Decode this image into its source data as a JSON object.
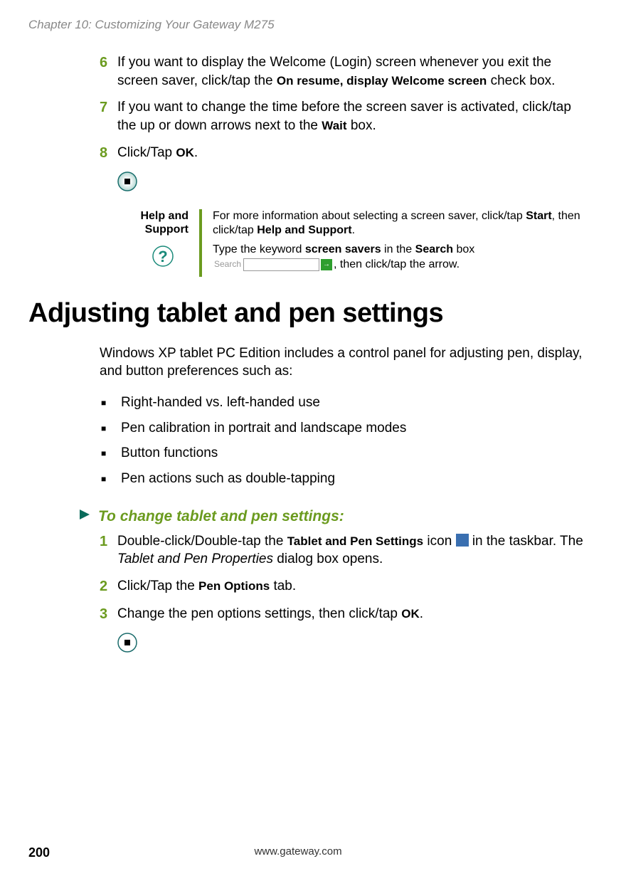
{
  "chapter_header": "Chapter 10: Customizing Your Gateway M275",
  "steps_a": {
    "s6": {
      "num": "6",
      "pre": "If you want to display the Welcome (Login) screen whenever you exit the screen saver, click/tap the ",
      "bold": "On resume, display Welcome screen",
      "post": " check box."
    },
    "s7": {
      "num": "7",
      "pre": "If you want to change the time before the screen saver is activated, click/tap the up or down arrows next to the ",
      "bold": "Wait",
      "post": " box."
    },
    "s8": {
      "num": "8",
      "pre": "Click/Tap ",
      "bold": "OK",
      "post": "."
    }
  },
  "help": {
    "label_l1": "Help and",
    "label_l2": "Support",
    "p1_pre": "For more information about selecting a screen saver, click/tap ",
    "p1_b1": "Start",
    "p1_mid": ", then click/tap ",
    "p1_b2": "Help and Support",
    "p1_post": ".",
    "p2_pre": "Type the keyword ",
    "p2_b1": "screen savers",
    "p2_mid": " in the ",
    "p2_b2": "Search",
    "p2_post1": " box ",
    "search_label": "Search",
    "p2_post2": ", then click/tap the arrow."
  },
  "heading": "Adjusting tablet and pen settings",
  "intro": "Windows XP tablet PC Edition includes a control panel for adjusting pen, display, and button preferences such as:",
  "bullets": {
    "b1": "Right-handed vs. left-handed use",
    "b2": "Pen calibration in portrait and landscape modes",
    "b3": "Button functions",
    "b4": "Pen actions such as double-tapping"
  },
  "procedure_title": "To change tablet and pen settings:",
  "steps_b": {
    "s1": {
      "num": "1",
      "pre": "Double-click/Double-tap the ",
      "bold": "Tablet and Pen Settings",
      "mid": " icon ",
      "post_pre": " in the taskbar. The ",
      "ital": "Tablet and Pen Properties",
      "post": " dialog box opens."
    },
    "s2": {
      "num": "2",
      "pre": "Click/Tap the ",
      "bold": "Pen Options",
      "post": " tab."
    },
    "s3": {
      "num": "3",
      "pre": "Change the pen options settings, then click/tap ",
      "bold": "OK",
      "post": "."
    }
  },
  "footer": {
    "page": "200",
    "url": "www.gateway.com"
  }
}
